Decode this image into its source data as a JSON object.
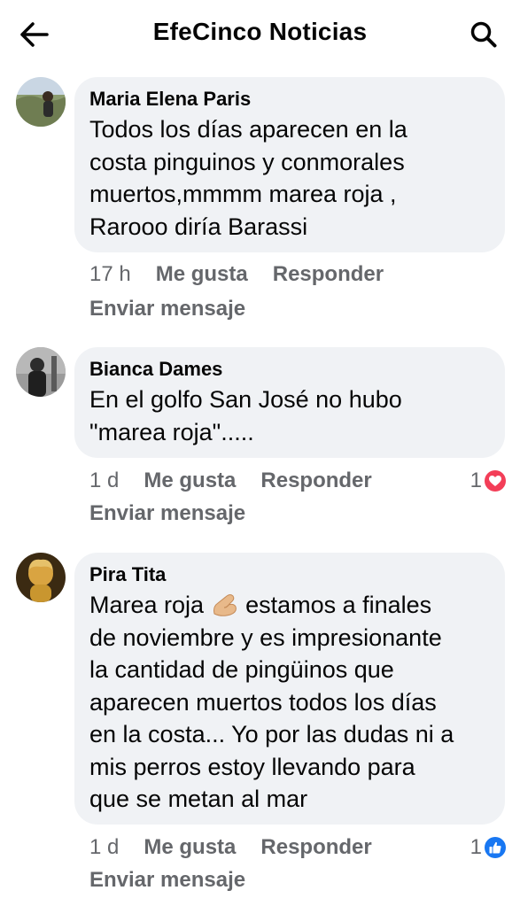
{
  "header": {
    "title": "EfeCinco Noticias",
    "back_icon": "arrow-left-icon",
    "search_icon": "search-icon"
  },
  "comments": [
    {
      "author": "Maria Elena Paris",
      "lines": [
        "Todos los días aparecen en la",
        "costa pinguinos y conmorales",
        "muertos,mmmm marea roja ,",
        "Rarooo diría Barassi"
      ],
      "time": "17 h",
      "like_label": "Me gusta",
      "reply_label": "Responder",
      "send_label": "Enviar mensaje",
      "reaction_count": ""
    },
    {
      "author": "Bianca Dames",
      "lines": [
        "En el golfo San José no hubo",
        "\"marea roja\"....."
      ],
      "time": "1 d",
      "like_label": "Me gusta",
      "reply_label": "Responder",
      "send_label": "Enviar mensaje",
      "reaction_count": "1",
      "reaction_type": "love-heart-icon",
      "reaction_color": "#f33e58"
    },
    {
      "author": "Pira Tita",
      "lines": [
        "Marea roja",
        " estamos a finales",
        "de noviembre y es impresionante",
        "la cantidad de pingüinos que",
        "aparecen muertos todos los días",
        "en la costa... Yo por las dudas ni a",
        "mis perros estoy llevando para",
        "que se metan al mar"
      ],
      "inline_emoji": "pinching-hand-emoji-icon",
      "time": "1 d",
      "like_label": "Me gusta",
      "reply_label": "Responder",
      "send_label": "Enviar mensaje",
      "reaction_count": "1",
      "reaction_type": "like-thumb-icon",
      "reaction_color": "#1877f2"
    }
  ],
  "colors": {
    "bubble_bg": "#f0f2f5",
    "secondary_text": "#65676b",
    "primary_text": "#050505"
  }
}
